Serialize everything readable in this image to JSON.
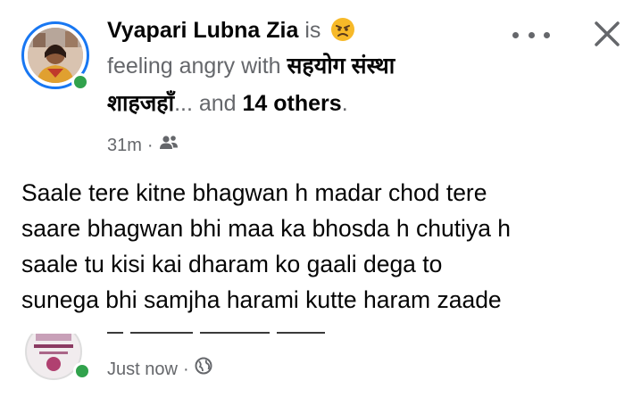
{
  "post": {
    "author": "Vyapari Lubna Zia",
    "is_word": "is",
    "feeling_text": "feeling angry with",
    "tagged_line1": "सहयोग संस्था",
    "tagged_line2": "शाहजहाँ",
    "ellipsis_and": "... and",
    "others": "14 others",
    "period": ".",
    "time": "31m",
    "separator": "·",
    "audience_icon": "friends-icon",
    "feeling_emoji": "angry-face-icon",
    "content_lines": [
      "Saale tere kitne bhagwan h  madar chod tere",
      "saare bhagwan bhi maa ka bhosda h chutiya h",
      "saale tu kisi kai dharam ko gaali dega to",
      "sunega bhi samjha harami kutte haram zaade"
    ]
  },
  "comment": {
    "time": "Just now",
    "separator": "·",
    "audience_icon": "globe-icon"
  },
  "colors": {
    "story_ring": "#1877f2",
    "online": "#31a24c",
    "secondary_text": "#65676b"
  }
}
